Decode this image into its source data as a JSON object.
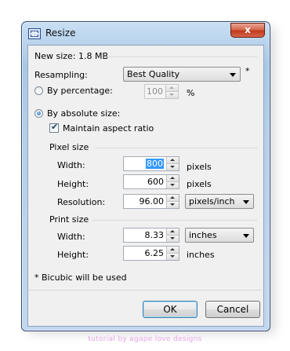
{
  "window": {
    "title": "Resize",
    "close_glyph": "x"
  },
  "dialog": {
    "new_size": "New size: 1.8 MB",
    "resampling": {
      "label": "Resampling:",
      "value": "Best Quality",
      "footnote_mark": "*"
    },
    "by_percentage": {
      "label": "By percentage:",
      "value": "100",
      "unit": "%",
      "selected": false
    },
    "by_absolute": {
      "label": "By absolute size:",
      "selected": true
    },
    "maintain_aspect": {
      "label": "Maintain aspect ratio",
      "checked": true
    },
    "pixel_size": {
      "label": "Pixel size",
      "width": {
        "label": "Width:",
        "value": "800",
        "unit": "pixels"
      },
      "height": {
        "label": "Height:",
        "value": "600",
        "unit": "pixels"
      },
      "resolution": {
        "label": "Resolution:",
        "value": "96.00",
        "unit": "pixels/inch"
      }
    },
    "print_size": {
      "label": "Print size",
      "width": {
        "label": "Width:",
        "value": "8.33",
        "unit": "inches"
      },
      "height": {
        "label": "Height:",
        "value": "6.25",
        "unit": "inches"
      }
    },
    "footnote": "* Bicubic will be used"
  },
  "buttons": {
    "ok": "OK",
    "cancel": "Cancel"
  },
  "watermark": "tutorial by agape love designs"
}
